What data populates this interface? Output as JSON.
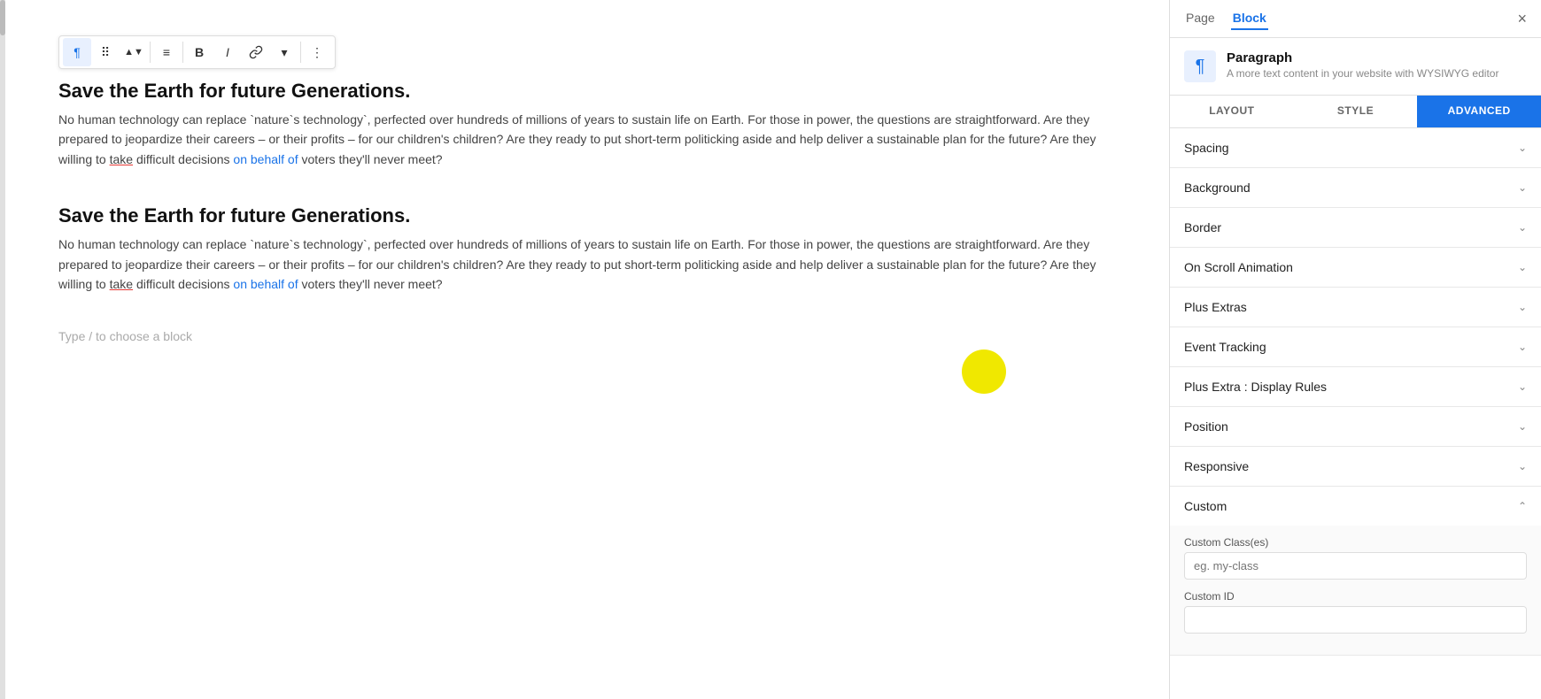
{
  "editor": {
    "toolbar": {
      "tools": [
        {
          "id": "paragraph",
          "symbol": "¶",
          "tooltip": "Paragraph"
        },
        {
          "id": "drag",
          "symbol": "⠿",
          "tooltip": "Drag"
        },
        {
          "id": "move",
          "symbol": "⌃⌄",
          "tooltip": "Move up/down"
        },
        {
          "id": "align",
          "symbol": "≡",
          "tooltip": "Align"
        },
        {
          "id": "bold",
          "symbol": "B",
          "tooltip": "Bold"
        },
        {
          "id": "italic",
          "symbol": "I",
          "tooltip": "Italic"
        },
        {
          "id": "link",
          "symbol": "🔗",
          "tooltip": "Link"
        },
        {
          "id": "more_down",
          "symbol": "▾",
          "tooltip": "More"
        },
        {
          "id": "options",
          "symbol": "⋮",
          "tooltip": "Options"
        }
      ]
    },
    "blocks": [
      {
        "heading": "Save the Earth for future Generations.",
        "body": "No human technology can replace `nature`s technology`, perfected over hundreds of millions of years to sustain life on Earth. For those in power, the questions are straightforward. Are they prepared to jeopardize their careers – or their profits – for our children's children? Are they ready to put short-term politicking aside and help deliver a sustainable plan for the future? Are they willing to take difficult decisions on behalf of voters they'll never meet?"
      },
      {
        "heading": "Save the Earth for future Generations.",
        "body": "No human technology can replace `nature`s technology`, perfected over hundreds of millions of years to sustain life on Earth. For those in power, the questions are straightforward. Are they prepared to jeopardize their careers – or their profits – for our children's children? Are they ready to put short-term politicking aside and help deliver a sustainable plan for the future? Are they willing to take difficult decisions on behalf of voters they'll never meet?"
      }
    ],
    "type_placeholder": "Type / to choose a block"
  },
  "panel": {
    "tabs": [
      "Page",
      "Block"
    ],
    "active_tab": "Block",
    "close_label": "×",
    "block_info": {
      "icon": "¶",
      "title": "Paragraph",
      "description": "A more text content in your website with WYSIWYG editor"
    },
    "sub_tabs": [
      "LAYOUT",
      "STYLE",
      "ADVANCED"
    ],
    "active_sub_tab": "ADVANCED",
    "accordion_sections": [
      {
        "id": "spacing",
        "label": "Spacing",
        "expanded": false
      },
      {
        "id": "background",
        "label": "Background",
        "expanded": false
      },
      {
        "id": "border",
        "label": "Border",
        "expanded": false
      },
      {
        "id": "on_scroll_animation",
        "label": "On Scroll Animation",
        "expanded": false
      },
      {
        "id": "plus_extras",
        "label": "Plus Extras",
        "expanded": false
      },
      {
        "id": "event_tracking",
        "label": "Event Tracking",
        "expanded": false
      },
      {
        "id": "plus_extra_display_rules",
        "label": "Plus Extra : Display Rules",
        "expanded": false
      },
      {
        "id": "position",
        "label": "Position",
        "expanded": false
      },
      {
        "id": "responsive",
        "label": "Responsive",
        "expanded": false
      },
      {
        "id": "custom",
        "label": "Custom",
        "expanded": true
      }
    ],
    "custom_section": {
      "custom_classes_label": "Custom Class(es)",
      "custom_classes_placeholder": "eg. my-class",
      "custom_id_label": "Custom ID"
    }
  }
}
